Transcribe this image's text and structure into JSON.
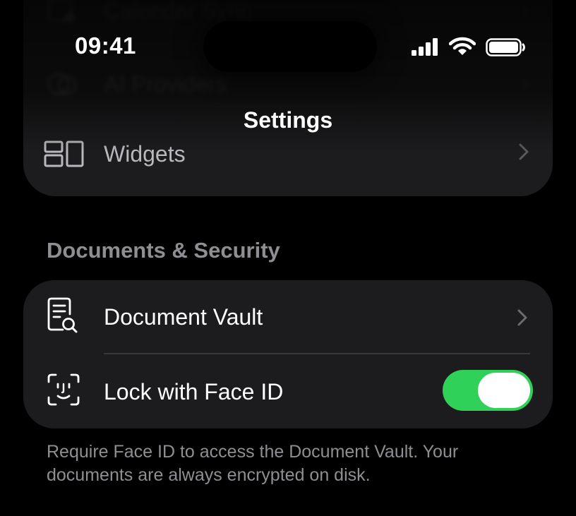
{
  "status_bar": {
    "time": "09:41"
  },
  "nav": {
    "title": "Settings"
  },
  "top_group": {
    "rows": [
      {
        "label": "Calendar Sync",
        "icon": "calendar-sync-icon"
      },
      {
        "label": "AI Providers",
        "icon": "ai-providers-icon"
      },
      {
        "label": "Widgets",
        "icon": "widgets-icon"
      }
    ]
  },
  "documents_security": {
    "header": "Documents & Security",
    "vault": {
      "label": "Document Vault",
      "icon": "document-search-icon"
    },
    "face_id": {
      "label": "Lock with Face ID",
      "icon": "face-id-icon",
      "enabled": true
    },
    "footer": "Require Face ID to access the Document Vault. Your documents are always encrypted on disk."
  },
  "colors": {
    "background": "#000000",
    "card": "#1c1c1e",
    "toggle_on": "#30d158",
    "secondary_text": "#8e8e93"
  }
}
